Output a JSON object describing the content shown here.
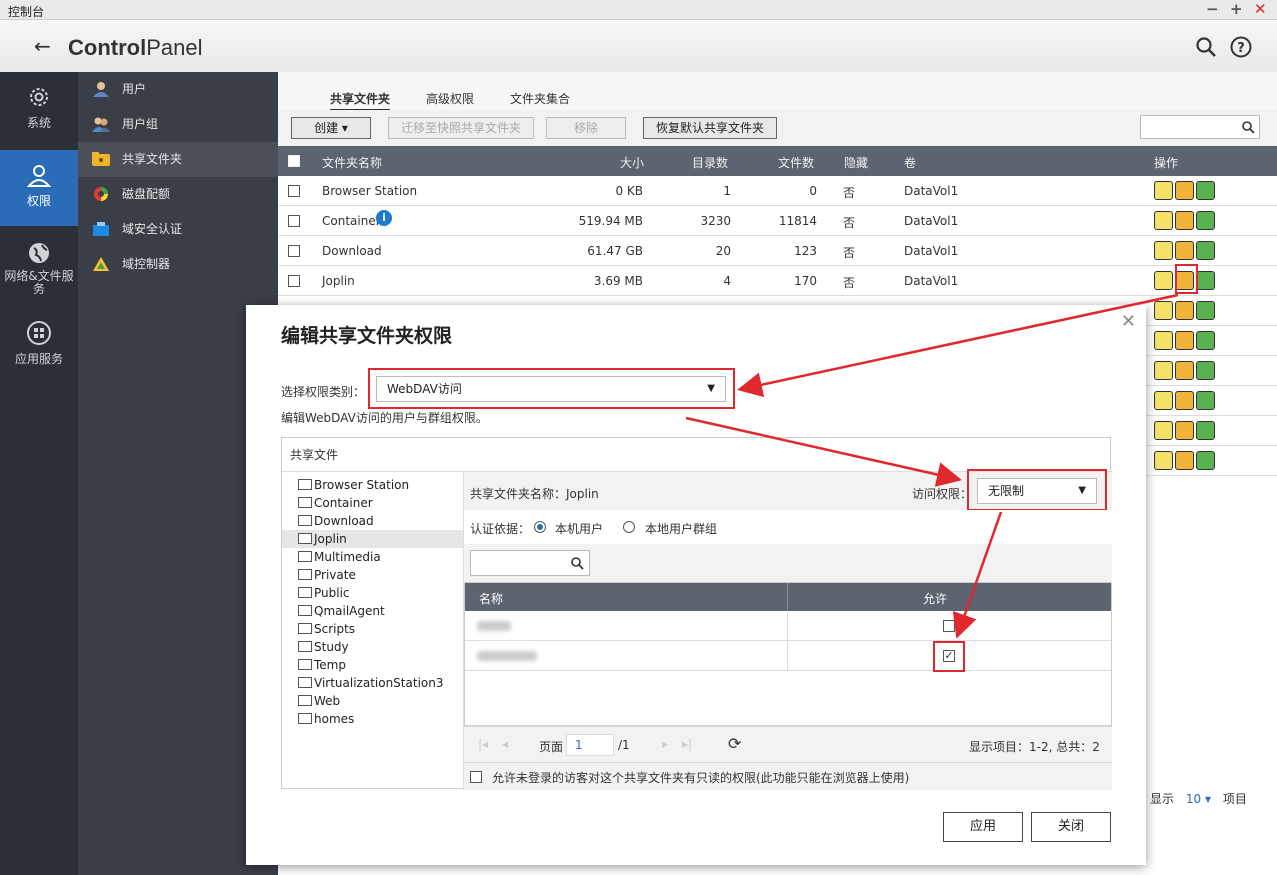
{
  "window": {
    "title": "控制台"
  },
  "header": {
    "brand_bold": "Control",
    "brand_rest": "Panel"
  },
  "leftnav": [
    {
      "label": "系统",
      "icon": "gear-icon"
    },
    {
      "label": "权限",
      "icon": "user-icon"
    },
    {
      "label": "网络&文件服务",
      "icon": "globe-icon"
    },
    {
      "label": "应用服务",
      "icon": "apps-icon"
    }
  ],
  "submenu": [
    {
      "label": "用户",
      "icon": "user-icon"
    },
    {
      "label": "用户组",
      "icon": "group-icon"
    },
    {
      "label": "共享文件夹",
      "icon": "folder-share-icon"
    },
    {
      "label": "磁盘配额",
      "icon": "quota-pie-icon"
    },
    {
      "label": "域安全认证",
      "icon": "domain-auth-icon"
    },
    {
      "label": "域控制器",
      "icon": "domain-controller-icon"
    }
  ],
  "tabs": [
    "共享文件夹",
    "高级权限",
    "文件夹集合"
  ],
  "toolbar": {
    "create": "创建",
    "migrate": "迁移至快照共享文件夹",
    "remove": "移除",
    "restore": "恢复默认共享文件夹"
  },
  "grid": {
    "columns": [
      "文件夹名称",
      "大小",
      "目录数",
      "文件数",
      "隐藏",
      "卷",
      "操作"
    ],
    "rows": [
      {
        "name": "Browser Station",
        "size": "0 KB",
        "dirs": "1",
        "files": "0",
        "hidden": "否",
        "vol": "DataVol1"
      },
      {
        "name": "Container",
        "size": "519.94 MB",
        "dirs": "3230",
        "files": "11814",
        "hidden": "否",
        "vol": "DataVol1"
      },
      {
        "name": "Download",
        "size": "61.47 GB",
        "dirs": "20",
        "files": "123",
        "hidden": "否",
        "vol": "DataVol1"
      },
      {
        "name": "Joplin",
        "size": "3.69 MB",
        "dirs": "4",
        "files": "170",
        "hidden": "否",
        "vol": "DataVol1"
      }
    ]
  },
  "footer": {
    "show": "显示",
    "count": "10",
    "items": "项目"
  },
  "modal": {
    "title": "编辑共享文件夹权限",
    "type_label": "选择权限类别：",
    "type_value": "WebDAV访问",
    "desc": "编辑WebDAV访问的用户与群组权限。",
    "panel_title": "共享文件",
    "tree": [
      "Browser Station",
      "Container",
      "Download",
      "Joplin",
      "Multimedia",
      "Private",
      "Public",
      "QmailAgent",
      "Scripts",
      "Study",
      "Temp",
      "VirtualizationStation3",
      "Web",
      "homes"
    ],
    "folder_name_label": "共享文件夹名称：Joplin",
    "access_label": "访问权限：",
    "access_value": "无限制",
    "auth_label": "认证依据：",
    "auth_local_user": "本机用户",
    "auth_local_group": "本地用户群组",
    "table_cols": [
      "名称",
      "允许"
    ],
    "page_label": "页面",
    "page_value": "1",
    "page_total": "/1",
    "display_info": "显示项目：1-2, 总共：2",
    "guest_text": "允许未登录的访客对这个共享文件夹有只读的权限(此功能只能在浏览器上使用)",
    "apply": "应用",
    "close": "关闭"
  }
}
